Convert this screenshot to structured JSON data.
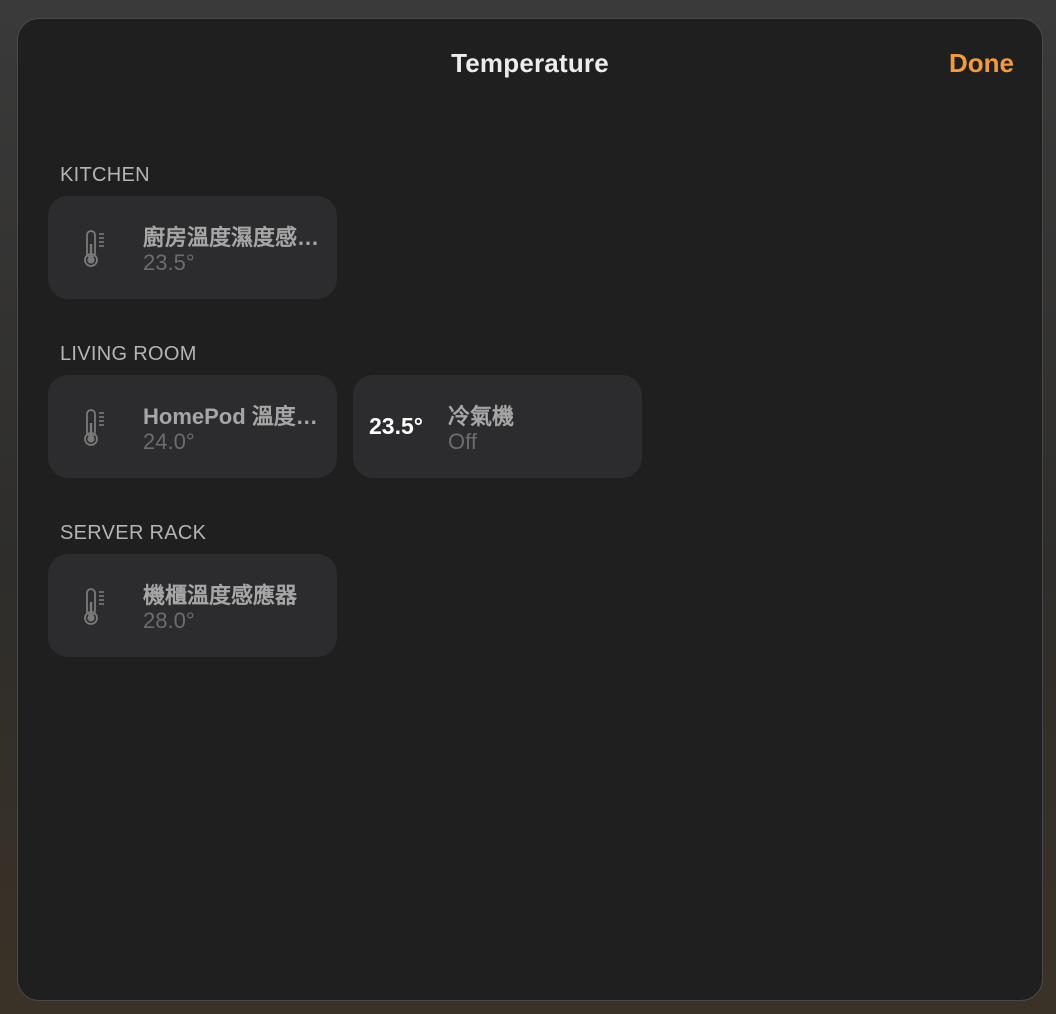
{
  "header": {
    "title": "Temperature",
    "done_label": "Done"
  },
  "colors": {
    "accent": "#f29a3c",
    "sheet_bg": "#1f1f1f",
    "tile_bg": "#2c2c2e"
  },
  "sections": [
    {
      "label": "KITCHEN",
      "tiles": [
        {
          "icon": "thermometer-icon",
          "name": "廚房溫度濕度感應器",
          "value": "23.5°"
        }
      ]
    },
    {
      "label": "LIVING ROOM",
      "tiles": [
        {
          "icon": "thermometer-icon",
          "name": "HomePod 溫度感應器",
          "value": "24.0°"
        },
        {
          "current_temp": "23.5°",
          "name": "冷氣機",
          "status": "Off"
        }
      ]
    },
    {
      "label": "SERVER RACK",
      "tiles": [
        {
          "icon": "thermometer-icon",
          "name": "機櫃溫度感應器",
          "value": "28.0°"
        }
      ]
    }
  ]
}
